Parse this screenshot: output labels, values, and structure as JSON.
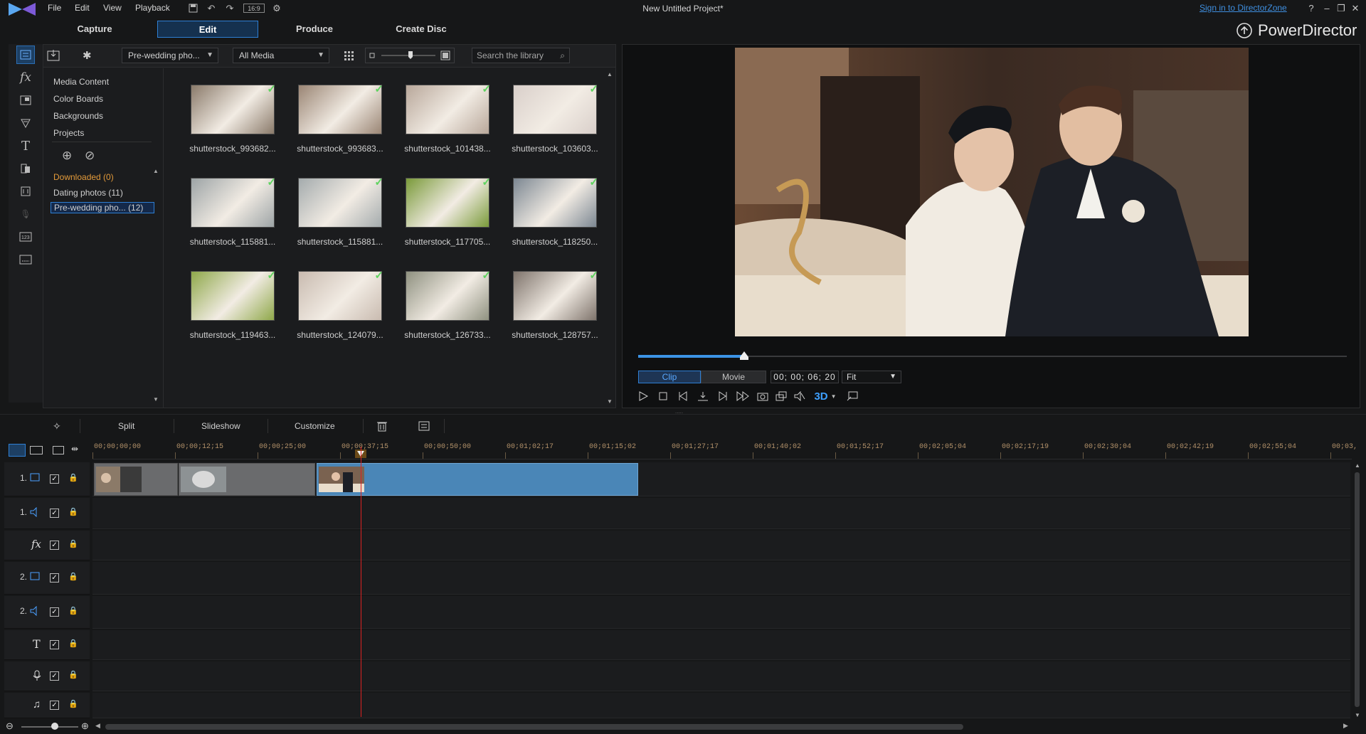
{
  "menu": {
    "file": "File",
    "edit": "Edit",
    "view": "View",
    "playback": "Playback",
    "aspect": "16:9"
  },
  "project_title": "New Untitled Project*",
  "signin": "Sign in to DirectorZone",
  "help": "?",
  "modes": {
    "capture": "Capture",
    "edit": "Edit",
    "produce": "Produce",
    "create_disc": "Create Disc"
  },
  "brand": "PowerDirector",
  "library": {
    "album_dropdown": "Pre-wedding pho...",
    "filter_dropdown": "All Media",
    "search_placeholder": "Search the library",
    "tree": {
      "media_content": "Media Content",
      "color_boards": "Color Boards",
      "backgrounds": "Backgrounds",
      "projects": "Projects",
      "downloaded": "Downloaded  (0)",
      "dating": "Dating photos  (11)",
      "prewedding": "Pre-wedding pho...  (12)"
    },
    "items": [
      {
        "label": "shutterstock_993682...",
        "tone": "#8a7a6a"
      },
      {
        "label": "shutterstock_993683...",
        "tone": "#9a8574"
      },
      {
        "label": "shutterstock_101438...",
        "tone": "#b8a79a"
      },
      {
        "label": "shutterstock_103603...",
        "tone": "#d9cfca"
      },
      {
        "label": "shutterstock_115881...",
        "tone": "#9da4a6"
      },
      {
        "label": "shutterstock_115881...",
        "tone": "#a4abad"
      },
      {
        "label": "shutterstock_117705...",
        "tone": "#7a9a3a"
      },
      {
        "label": "shutterstock_118250...",
        "tone": "#7c8792"
      },
      {
        "label": "shutterstock_119463...",
        "tone": "#8fa84a"
      },
      {
        "label": "shutterstock_124079...",
        "tone": "#c9bbb0"
      },
      {
        "label": "shutterstock_126733...",
        "tone": "#8f9180"
      },
      {
        "label": "shutterstock_128757...",
        "tone": "#7f746c"
      }
    ]
  },
  "preview": {
    "clip": "Clip",
    "movie": "Movie",
    "timecode": "00; 00; 06; 20",
    "fit": "Fit",
    "threed": "3D",
    "progress": 0.15
  },
  "edit_toolbar": {
    "split": "Split",
    "slideshow": "Slideshow",
    "customize": "Customize"
  },
  "ruler_ticks": [
    "00;00;00;00",
    "00;00;12;15",
    "00;00;25;00",
    "00;00;37;15",
    "00;00;50;00",
    "00;01;02;17",
    "00;01;15;02",
    "00;01;27;17",
    "00;01;40;02",
    "00;01;52;17",
    "00;02;05;04",
    "00;02;17;19",
    "00;02;30;04",
    "00;02;42;19",
    "00;02;55;04",
    "00;03,"
  ],
  "tracks": {
    "t1v": "1.",
    "t1a": "1.",
    "t2v": "2.",
    "t2a": "2."
  },
  "colors": {
    "accent": "#2e7fd4",
    "selected_clip": "#4a86b7",
    "playhead": "#dd2222",
    "check": "#5fd35f"
  }
}
